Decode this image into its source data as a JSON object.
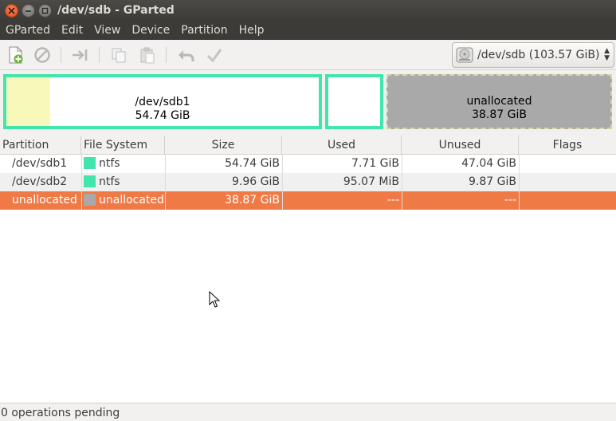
{
  "window": {
    "title": "/dev/sdb - GParted"
  },
  "menu": [
    "GParted",
    "Edit",
    "View",
    "Device",
    "Partition",
    "Help"
  ],
  "toolbar": {
    "buttons": [
      "new-partition-icon",
      "delete-icon",
      "resize-move-icon",
      "copy-icon",
      "paste-icon",
      "undo-icon",
      "apply-icon"
    ],
    "device_select": "/dev/sdb  (103.57 GiB)"
  },
  "disk_map": {
    "partitions": [
      {
        "name": "/dev/sdb1",
        "size": "54.74 GiB"
      },
      {
        "name": "/dev/sdb2"
      },
      {
        "name": "unallocated",
        "size": "38.87 GiB"
      }
    ]
  },
  "table": {
    "headers": [
      "Partition",
      "File System",
      "Size",
      "Used",
      "Unused",
      "Flags"
    ],
    "rows": [
      {
        "partition": "/dev/sdb1",
        "fs": "ntfs",
        "size": "54.74 GiB",
        "used": "7.71 GiB",
        "unused": "47.04 GiB",
        "flags": ""
      },
      {
        "partition": "/dev/sdb2",
        "fs": "ntfs",
        "size": "9.96 GiB",
        "used": "95.07 MiB",
        "unused": "9.87 GiB",
        "flags": ""
      },
      {
        "partition": "unallocated",
        "fs": "unallocated",
        "size": "38.87 GiB",
        "used": "---",
        "unused": "---",
        "flags": ""
      }
    ]
  },
  "status": "0 operations pending",
  "colors": {
    "ntfs": "#42e5ac",
    "unallocated": "#a9a9a9",
    "selection": "#ef7a46"
  }
}
